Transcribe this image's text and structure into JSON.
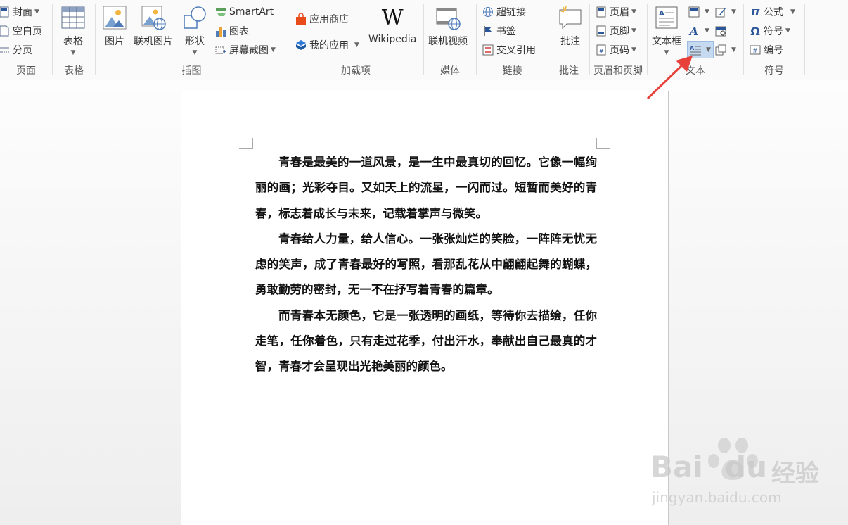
{
  "ribbon": {
    "pages": {
      "label": "页面",
      "items": [
        "封面",
        "空白页",
        "分页"
      ]
    },
    "table": {
      "label": "表格",
      "button": "表格"
    },
    "illustrations": {
      "label": "插图",
      "picture": "图片",
      "online_picture": "联机图片",
      "shapes": "形状",
      "smartart": "SmartArt",
      "chart": "图表",
      "screenshot": "屏幕截图"
    },
    "addins": {
      "label": "加载项",
      "store": "应用商店",
      "my_apps": "我的应用",
      "wikipedia": "Wikipedia",
      "wikipedia_glyph": "W"
    },
    "media": {
      "label": "媒体",
      "online_video": "联机视频"
    },
    "links": {
      "label": "链接",
      "hyperlink": "超链接",
      "bookmark": "书签",
      "cross_reference": "交叉引用"
    },
    "comments": {
      "label": "批注",
      "comment": "批注"
    },
    "header_footer": {
      "label": "页眉和页脚",
      "header": "页眉",
      "footer": "页脚",
      "page_number": "页码"
    },
    "text": {
      "label": "文本",
      "text_box": "文本框"
    },
    "symbols": {
      "label": "符号",
      "equation": "公式",
      "symbol": "符号",
      "number": "编号"
    }
  },
  "document": {
    "paragraphs": [
      "青春是最美的一道风景，是一生中最真切的回忆。它像一幅绚丽的画；光彩夺目。又如天上的流星，一闪而过。短暂而美好的青春，标志着成长与未来，记载着掌声与微笑。",
      "青春给人力量，给人信心。一张张灿烂的笑脸，一阵阵无忧无虑的笑声，成了青春最好的写照，看那乱花从中翩翩起舞的蝴蝶，勇敢勤劳的密封，无一不在抒写着青春的篇章。",
      "而青春本无颜色，它是一张透明的画纸，等待你去描绘，任你走笔，任你着色，只有走过花季，付出汗水，奉献出自己最真的才智，青春才会呈现出光艳美丽的颜色。"
    ]
  },
  "watermark": {
    "brand": "Bai",
    "brand2": "du",
    "cn": "经验",
    "url": "jingyan.baidu.com"
  },
  "colors": {
    "arrow": "#e8413a",
    "accent_blue": "#2b579a",
    "ribbon_bg": "#fafafa"
  }
}
